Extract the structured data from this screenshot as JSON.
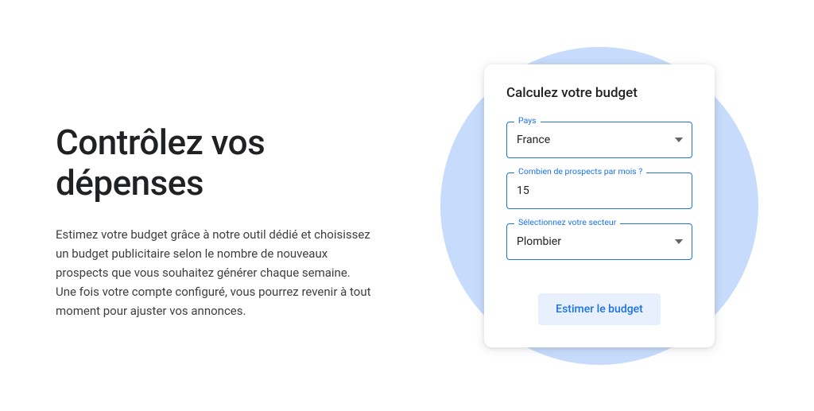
{
  "left": {
    "headline": "Contrôlez vos dépenses",
    "description": "Estimez votre budget grâce à notre outil dédié et choisissez un budget publicitaire selon le nombre de nouveaux prospects que vous souhaitez générer chaque semaine. Une fois votre compte configuré, vous pourrez revenir à tout moment pour ajuster vos annonces."
  },
  "card": {
    "title": "Calculez votre budget",
    "fields": {
      "country": {
        "label": "Pays",
        "value": "France"
      },
      "prospects": {
        "label": "Combien de prospects par mois ?",
        "value": "15"
      },
      "sector": {
        "label": "Sélectionnez votre secteur",
        "value": "Plombier"
      }
    },
    "cta": "Estimer le budget"
  }
}
